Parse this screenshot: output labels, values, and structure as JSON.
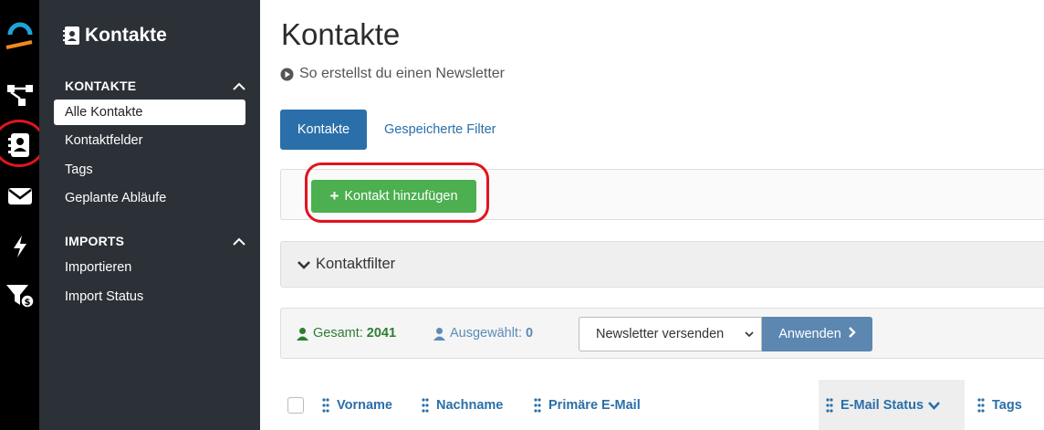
{
  "sidebar": {
    "title": "Kontakte",
    "sections": [
      {
        "label": "KONTAKTE",
        "items": [
          "Alle Kontakte",
          "Kontaktfelder",
          "Tags",
          "Geplante Abläufe"
        ]
      },
      {
        "label": "IMPORTS",
        "items": [
          "Importieren",
          "Import Status"
        ]
      }
    ],
    "active_item": "Alle Kontakte"
  },
  "rail": {
    "icons": [
      "logo-icon",
      "automation-flow-icon",
      "contacts-icon",
      "email-icon",
      "lightning-icon",
      "funnel-icon"
    ],
    "highlighted": "contacts-icon"
  },
  "main": {
    "title": "Kontakte",
    "howto_link": "So erstellst du einen Newsletter",
    "tabs": [
      {
        "label": "Kontakte",
        "active": true
      },
      {
        "label": "Gespeicherte Filter",
        "active": false
      }
    ],
    "add_button": "Kontakt hinzufügen",
    "filter_label": "Kontaktfilter",
    "stats": {
      "total_label": "Gesamt:",
      "total_value": "2041",
      "selected_label": "Ausgewählt:",
      "selected_value": "0"
    },
    "bulk_action": {
      "selected": "Newsletter versenden",
      "apply_label": "Anwenden"
    },
    "columns": [
      "Vorname",
      "Nachname",
      "Primäre E-Mail",
      "E-Mail Status",
      "Tags"
    ],
    "sorted_column": "E-Mail Status"
  },
  "colors": {
    "sidebar_bg": "#2c3138",
    "primary": "#2a6fa9",
    "success": "#4caf50",
    "highlight_ring": "#e0141e"
  }
}
